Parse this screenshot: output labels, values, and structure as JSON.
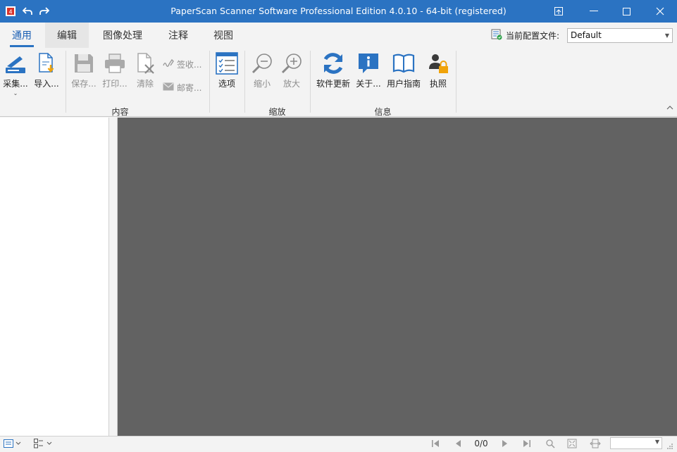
{
  "window": {
    "title": "PaperScan Scanner Software Professional Edition 4.0.10 - 64-bit (registered)"
  },
  "tabs": [
    {
      "label": "通用"
    },
    {
      "label": "编辑"
    },
    {
      "label": "图像处理"
    },
    {
      "label": "注释"
    },
    {
      "label": "视图"
    }
  ],
  "profile": {
    "label": "当前配置文件:",
    "value": "Default"
  },
  "ribbon": {
    "content_group": {
      "label": "内容",
      "acquire": "采集...",
      "import": "导入...",
      "save": "保存...",
      "print": "打印...",
      "clear": "清除",
      "sign": "签收...",
      "mail": "邮寄...",
      "options": "选项"
    },
    "zoom_group": {
      "label": "缩放",
      "zoom_out": "缩小",
      "zoom_in": "放大"
    },
    "info_group": {
      "label": "信息",
      "update": "软件更新",
      "about": "关于...",
      "guide": "用户指南",
      "license": "执照"
    }
  },
  "statusbar": {
    "page_count": "0/0"
  },
  "colors": {
    "titlebar": "#2b73c2",
    "canvas": "#626262",
    "accent": "#2b73c2"
  }
}
